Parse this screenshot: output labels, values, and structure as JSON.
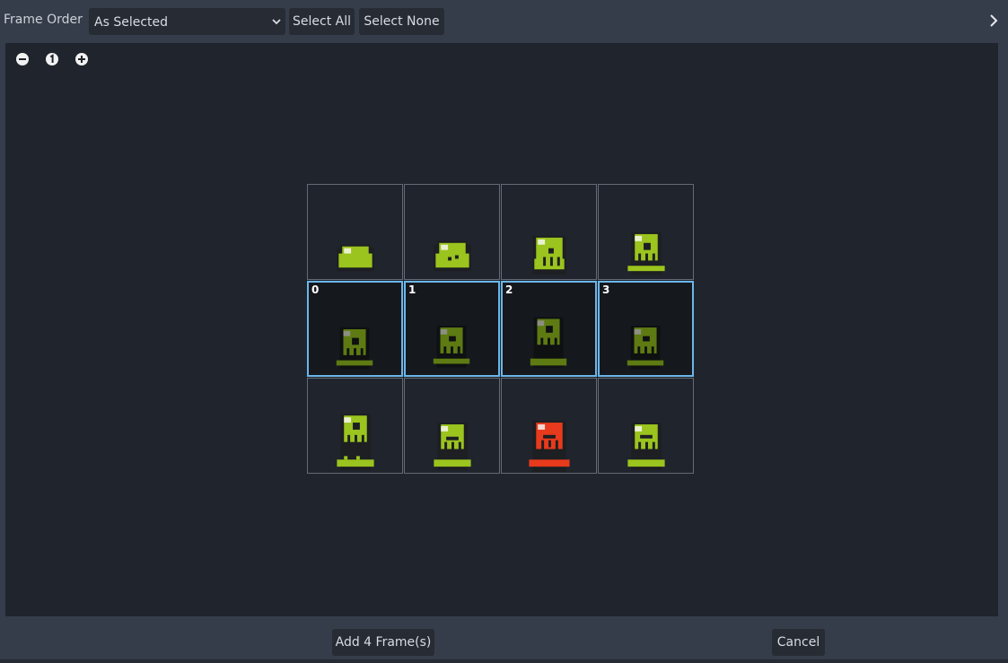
{
  "toolbar": {
    "frame_order_label": "Frame Order",
    "frame_order_value": "As Selected",
    "select_all_label": "Select All",
    "select_none_label": "Select None"
  },
  "icons": {
    "expand": "chevron-right-icon",
    "dropdown": "chevron-down-icon",
    "zoom_out": "zoom-out-icon",
    "zoom_reset": "zoom-reset-icon",
    "zoom_in": "zoom-in-icon"
  },
  "sheet": {
    "columns": 4,
    "rows": 3,
    "selected_frames": [
      "0",
      "1",
      "2",
      "3"
    ]
  },
  "footer": {
    "add_label": "Add 4 Frame(s)",
    "cancel_label": "Cancel"
  },
  "colors": {
    "accent": "#6bb6e8",
    "slime_green": "#9bc41e",
    "slime_red": "#e83a1c"
  }
}
